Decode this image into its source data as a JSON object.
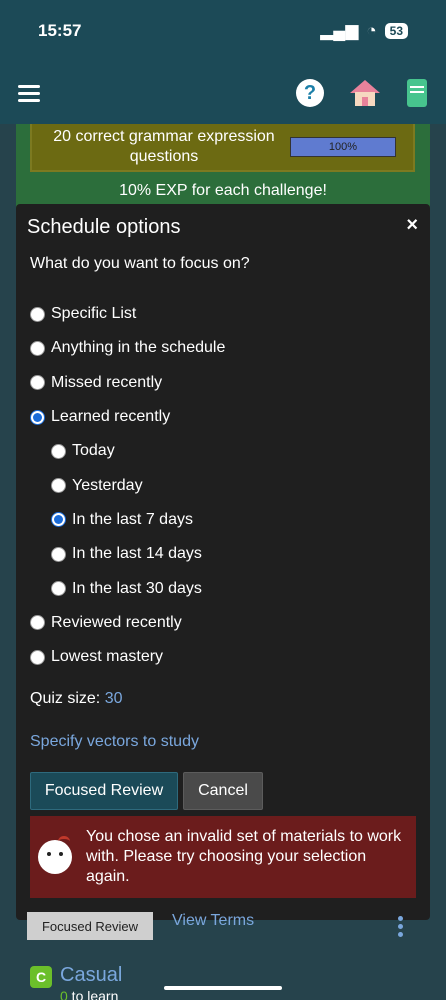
{
  "status": {
    "time": "15:57",
    "battery": "53"
  },
  "nav": {
    "icons": [
      "menu-icon",
      "help-icon",
      "home-icon",
      "book-icon"
    ]
  },
  "challenge": {
    "text": "20 correct grammar expression questions",
    "progress": "100%",
    "exp_note": "10% EXP for each challenge!"
  },
  "modal": {
    "title": "Schedule options",
    "close": "×",
    "question": "What do you want to focus on?",
    "options": [
      {
        "label": "Specific List",
        "checked": false,
        "sub": false
      },
      {
        "label": "Anything in the schedule",
        "checked": false,
        "sub": false
      },
      {
        "label": "Missed recently",
        "checked": false,
        "sub": false
      },
      {
        "label": "Learned recently",
        "checked": true,
        "sub": false
      },
      {
        "label": "Today",
        "checked": false,
        "sub": true
      },
      {
        "label": "Yesterday",
        "checked": false,
        "sub": true
      },
      {
        "label": "In the last 7 days",
        "checked": true,
        "sub": true
      },
      {
        "label": "In the last 14 days",
        "checked": false,
        "sub": true
      },
      {
        "label": "In the last 30 days",
        "checked": false,
        "sub": true
      },
      {
        "label": "Reviewed recently",
        "checked": false,
        "sub": false
      },
      {
        "label": "Lowest mastery",
        "checked": false,
        "sub": false
      }
    ],
    "quiz_size_label": "Quiz size:",
    "quiz_size_value": "30",
    "specify_link": "Specify vectors to study",
    "focus_button": "Focused Review",
    "cancel_button": "Cancel",
    "error": "You chose an invalid set of materials to work with. Please try choosing your selection again."
  },
  "below": {
    "focused_review": "Focused Review",
    "view_terms": "View Terms",
    "badge": "C",
    "casual": "Casual",
    "to_learn_num": "0",
    "to_learn_text": " to learn"
  }
}
